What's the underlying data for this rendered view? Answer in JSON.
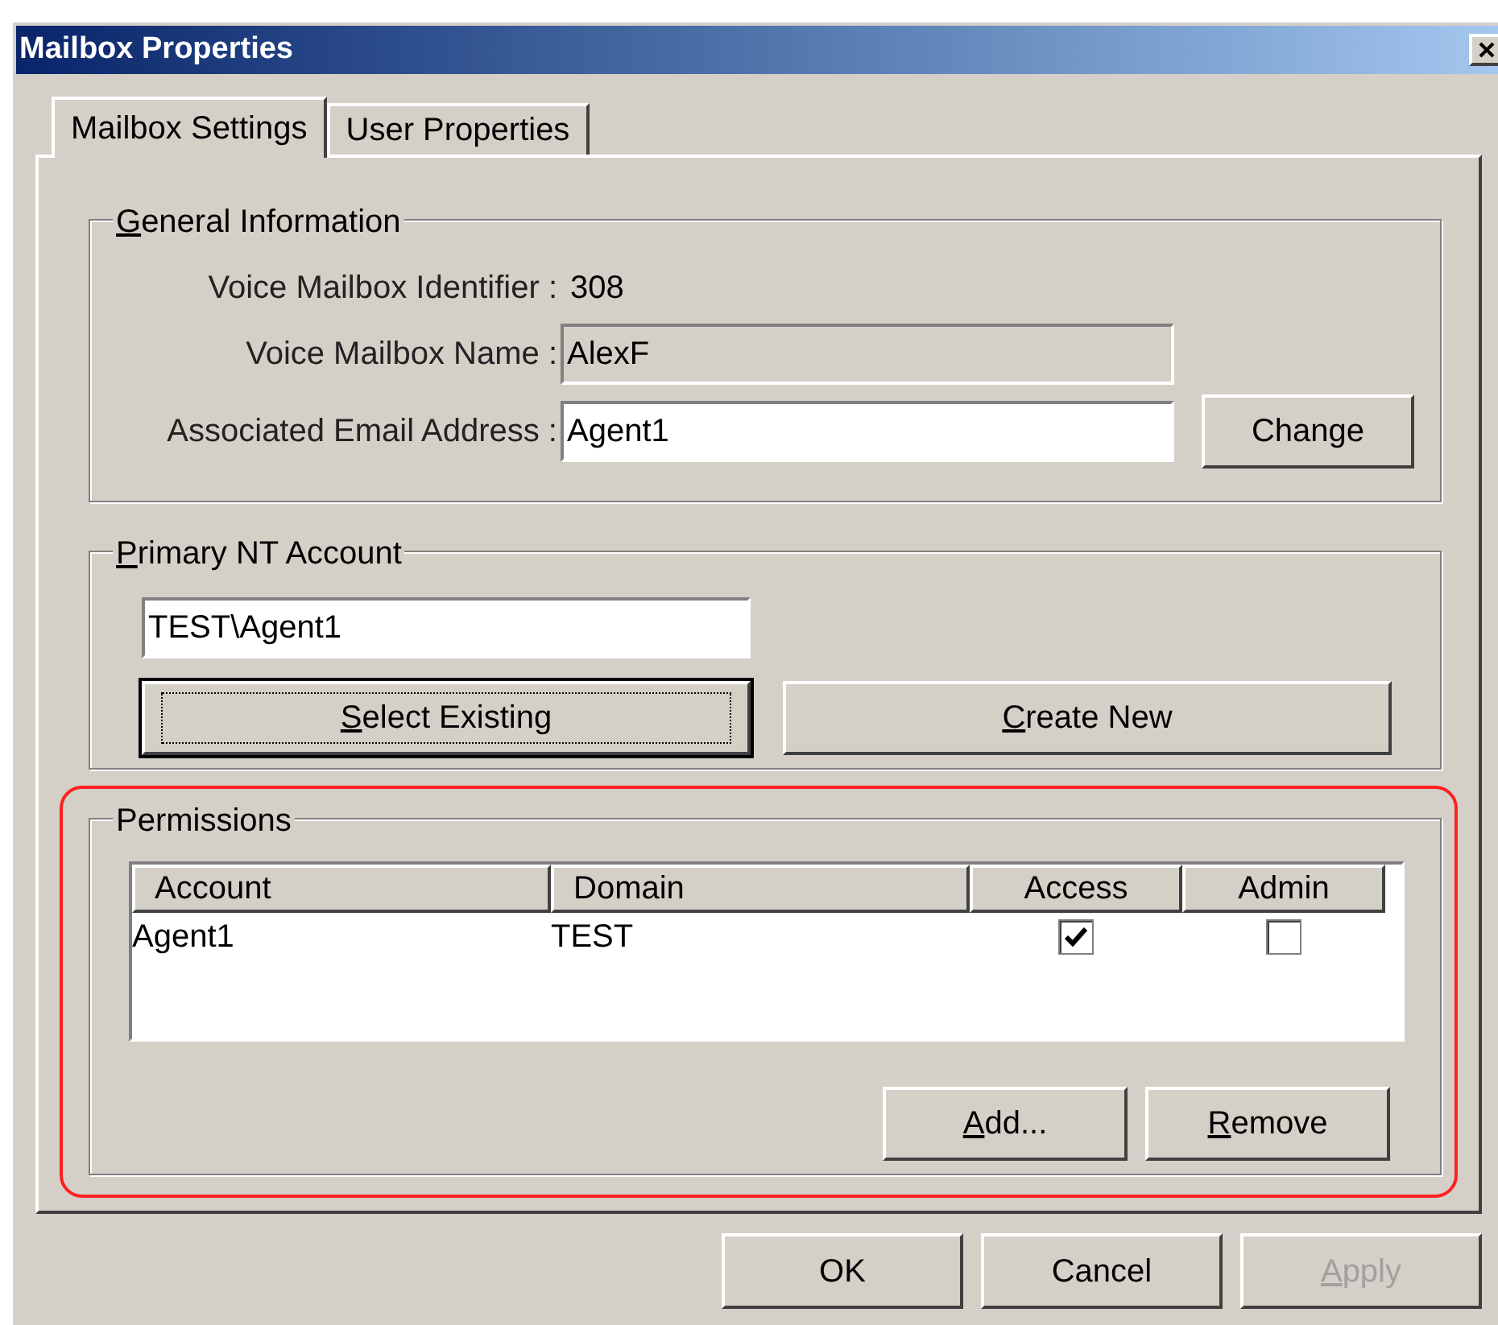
{
  "window": {
    "title": "Mailbox Properties"
  },
  "tabs": [
    {
      "label": "Mailbox Settings",
      "selected": true
    },
    {
      "label": "User Properties",
      "selected": false
    }
  ],
  "general": {
    "title": "General Information",
    "underline_first": true,
    "identifier_label": "Voice Mailbox Identifier :",
    "identifier_value": "308",
    "name_label": "Voice Mailbox Name :",
    "name_value": "AlexF",
    "name_disabled": true,
    "email_label": "Associated Email Address :",
    "email_value": "Agent1",
    "change_button": {
      "label": "Change",
      "underline_first": false
    }
  },
  "primary": {
    "title": "Primary NT Account",
    "underline_first": true,
    "account_value": "TEST\\Agent1",
    "buttons": [
      {
        "label": "Select Existing",
        "underline_first": true,
        "focused": true
      },
      {
        "label": "Create New",
        "underline_first": true,
        "focused": false
      }
    ]
  },
  "permissions": {
    "title": "Permissions",
    "underline_first": false,
    "highlighted": true,
    "columns": [
      "Account",
      "Domain",
      "Access",
      "Admin"
    ],
    "rows": [
      {
        "account": "Agent1",
        "domain": "TEST",
        "access": true,
        "admin": false
      }
    ],
    "buttons": [
      {
        "label": "Add...",
        "underline_first": true
      },
      {
        "label": "Remove",
        "underline_first": true
      }
    ]
  },
  "footer_buttons": [
    {
      "label": "OK",
      "underline_first": false,
      "disabled": false
    },
    {
      "label": "Cancel",
      "underline_first": false,
      "disabled": false
    },
    {
      "label": "Apply",
      "underline_first": true,
      "disabled": true
    }
  ]
}
